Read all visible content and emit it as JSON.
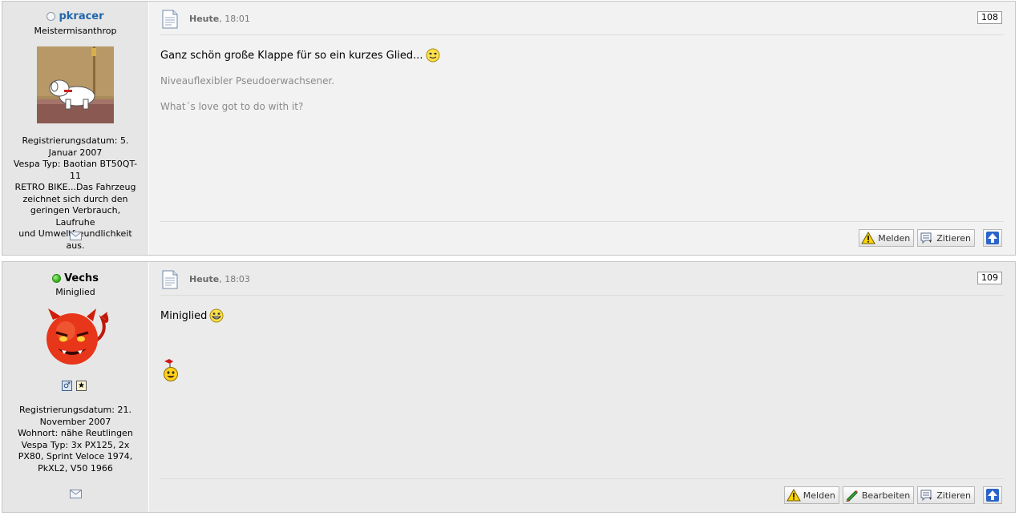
{
  "posts": [
    {
      "user": {
        "name": "pkracer",
        "status": "offline",
        "title": "Meistermisanthrop",
        "info": [
          "Registrierungsdatum: 5.",
          "Januar 2007",
          "Vespa Typ: Baotian BT50QT-11",
          "RETRO BIKE...Das Fahrzeug",
          "zeichnet sich durch den",
          "geringen Verbrauch, Laufruhe",
          "und Umweltfreundlichkeit aus."
        ]
      },
      "date_day": "Heute",
      "date_time": ", 18:01",
      "number": "108",
      "message": "Ganz schön große Klappe für so ein kurzes Glied...",
      "signature": [
        "Niveauflexibler Pseudoerwachsener.",
        "What´s love got to do with it?"
      ],
      "buttons": [
        "Melden",
        "Zitieren"
      ]
    },
    {
      "user": {
        "name": "Vechs",
        "status": "online",
        "title": "Miniglied",
        "info": [
          "Registrierungsdatum: 21.",
          "November 2007",
          "Wohnort: nähe Reutlingen",
          "Vespa Typ: 3x PX125, 2x",
          "PX80, Sprint Veloce 1974,",
          "PkXL2, V50 1966"
        ]
      },
      "date_day": "Heute",
      "date_time": ", 18:03",
      "number": "109",
      "message": "Miniglied",
      "buttons": [
        "Melden",
        "Bearbeiten",
        "Zitieren"
      ]
    }
  ],
  "colors": {
    "username_link": "#2266aa",
    "online": "#3fbb22"
  },
  "icons": [
    "envelope-icon",
    "document-icon",
    "warning-icon",
    "quote-icon",
    "pencil-icon",
    "arrow-up-icon",
    "smiley-icon",
    "grin-icon",
    "male-icon",
    "star-icon"
  ]
}
